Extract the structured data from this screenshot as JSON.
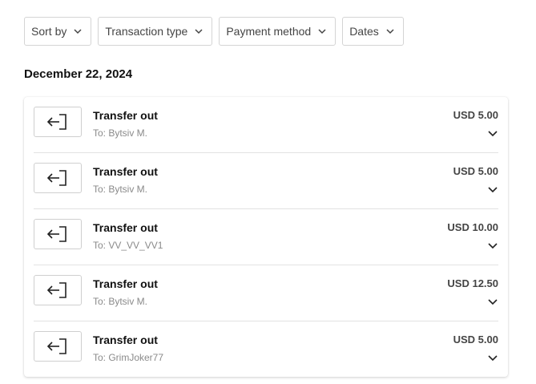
{
  "filters": {
    "sort_by": "Sort by",
    "transaction_type": "Transaction type",
    "payment_method": "Payment method",
    "dates": "Dates"
  },
  "date_heading": "December 22, 2024",
  "transactions": [
    {
      "title": "Transfer out",
      "recipient": "To: Bytsiv M.",
      "amount": "USD 5.00"
    },
    {
      "title": "Transfer out",
      "recipient": "To: Bytsiv M.",
      "amount": "USD 5.00"
    },
    {
      "title": "Transfer out",
      "recipient": "To: VV_VV_VV1",
      "amount": "USD 10.00"
    },
    {
      "title": "Transfer out",
      "recipient": "To: Bytsiv M.",
      "amount": "USD 12.50"
    },
    {
      "title": "Transfer out",
      "recipient": "To: GrimJoker77",
      "amount": "USD 5.00"
    }
  ],
  "icons": {
    "filter_chevron": "chevron-down-icon",
    "transaction_icon": "transfer-out-icon",
    "expand_icon": "chevron-down-icon"
  }
}
